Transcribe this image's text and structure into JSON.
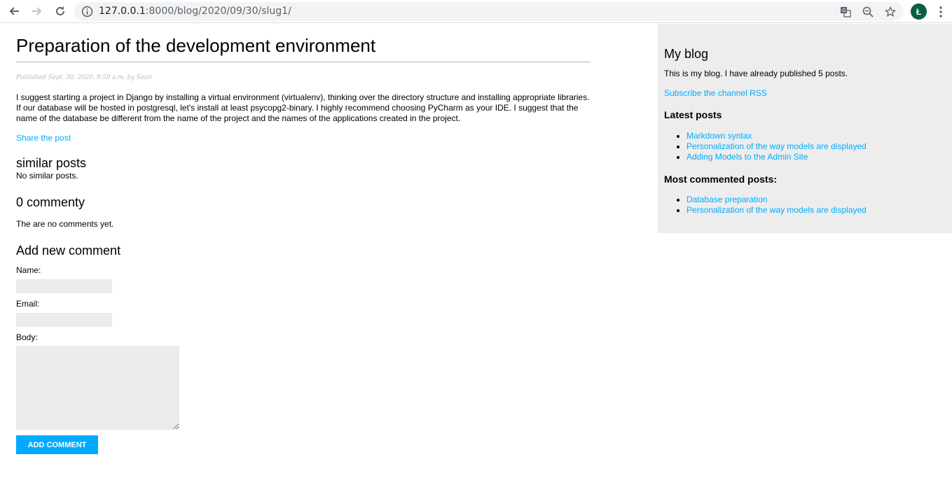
{
  "browser": {
    "url_host": "127.0.0.1",
    "url_rest": ":8000/blog/2020/09/30/slug1/",
    "avatar_letter": "Ł"
  },
  "post": {
    "title": "Preparation of the development environment",
    "meta": "Published Sept. 30, 2020, 9:59 a.m. by Sean",
    "body": "I suggest starting a project in Django by installing a virtual environment (virtualenv), thinking over the directory structure and installing appropriate libraries. If our database will be hosted in postgresql, let's install at least psycopg2-binary. I highly recommend choosing PyCharm as your IDE. I suggest that the name of the database be different from the name of the project and the names of the applications created in the project.",
    "share_label": "Share the post"
  },
  "similar": {
    "title": "similar posts",
    "empty_text": "No similar posts."
  },
  "comments": {
    "title": "0 commenty",
    "empty_text": "The are no comments yet."
  },
  "form": {
    "title": "Add new comment",
    "name_label": "Name:",
    "email_label": "Email:",
    "body_label": "Body:",
    "submit_label": "Add comment"
  },
  "sidebar": {
    "title": "My blog",
    "intro": "This is my blog. I have already published 5 posts.",
    "rss_label": "Subscribe the channel RSS",
    "latest_title": "Latest posts",
    "latest": [
      "Markdown syntax",
      "Personalization of the way models are displayed",
      "Adding Models to the Admin Site"
    ],
    "most_commented_title": "Most commented posts:",
    "most_commented": [
      "Database preparation",
      "Personalization of the way models are displayed"
    ]
  },
  "colors": {
    "link": "#00abff",
    "sidebar_bg": "#ededed",
    "field_bg": "#ebebeb"
  }
}
